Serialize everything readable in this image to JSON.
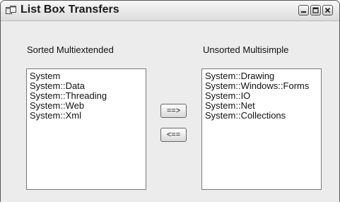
{
  "window": {
    "title": "List Box Transfers"
  },
  "left_panel": {
    "label": "Sorted Multiextended",
    "items": [
      "System",
      "System::Data",
      "System::Threading",
      "System::Web",
      "System::Xml"
    ]
  },
  "right_panel": {
    "label": "Unsorted Multisimple",
    "items": [
      "System::Drawing",
      "System::Windows::Forms",
      "System::IO",
      "System::Net",
      "System::Collections"
    ]
  },
  "buttons": {
    "move_right": "==>",
    "move_left": "<=="
  },
  "icons": {
    "app": "window-app-icon",
    "minimize": "minimize-icon",
    "maximize": "maximize-icon",
    "close": "close-icon"
  }
}
